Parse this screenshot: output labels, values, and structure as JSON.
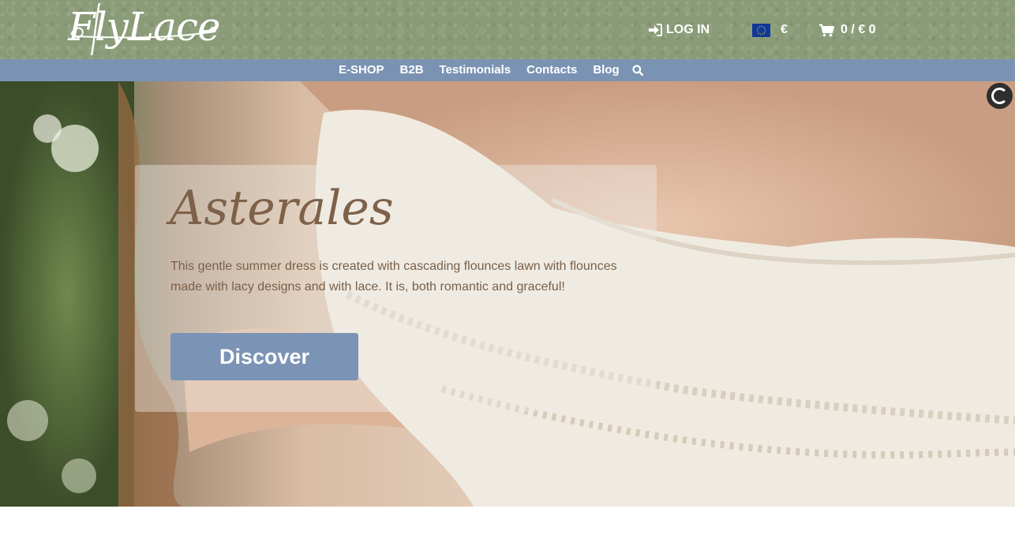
{
  "header": {
    "logo_text": "FlyLace",
    "login_label": "LOG IN",
    "currency_symbol": "€",
    "cart_summary": "0 / € 0"
  },
  "nav": {
    "items": [
      {
        "label": "E-SHOP"
      },
      {
        "label": "B2B"
      },
      {
        "label": "Testimonials"
      },
      {
        "label": "Contacts"
      },
      {
        "label": "Blog"
      }
    ]
  },
  "hero": {
    "title": "Asterales",
    "description": "This gentle summer dress is created with cascading flounces lawn with flounces made with lacy designs and with lace. It is, both romantic and graceful!",
    "button_label": "Discover"
  },
  "colors": {
    "header_bg": "#8a9b78",
    "nav_bg": "#7a93b3",
    "button_bg": "#7b94b5",
    "title_color": "#7e6149"
  },
  "icons": {
    "login": "sign-in-icon",
    "currency_flag": "eu-flag-icon",
    "cart": "shopping-cart-icon",
    "search": "search-icon",
    "loader": "spinner-icon"
  }
}
